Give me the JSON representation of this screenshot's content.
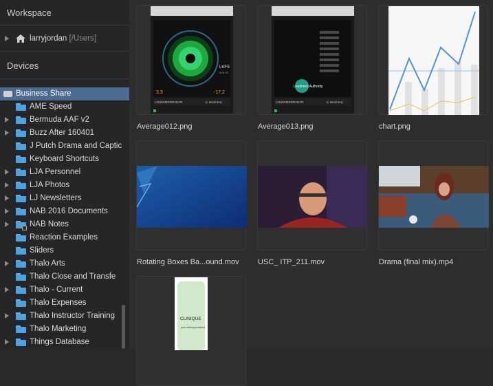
{
  "sidebar": {
    "workspace_header": "Workspace",
    "devices_header": "Devices",
    "user": {
      "name": "larryjordan",
      "path": "[/Users]"
    },
    "business_share": "Business Share",
    "folders": [
      {
        "label": "AME Speed",
        "expandable": false
      },
      {
        "label": "Bermuda AAF v2",
        "expandable": true
      },
      {
        "label": "Buzz After 160401",
        "expandable": true
      },
      {
        "label": "J Putch Drama and Captic",
        "expandable": false
      },
      {
        "label": "Keyboard Shortcuts",
        "expandable": false
      },
      {
        "label": "LJA Personnel",
        "expandable": true
      },
      {
        "label": "LJA Photos",
        "expandable": true
      },
      {
        "label": "LJ Newsletters",
        "expandable": true
      },
      {
        "label": "NAB 2016 Documents",
        "expandable": true
      },
      {
        "label": "NAB Notes",
        "expandable": true,
        "locked": true
      },
      {
        "label": "Reaction Examples",
        "expandable": false
      },
      {
        "label": "Sliders",
        "expandable": false
      },
      {
        "label": "Thalo Arts",
        "expandable": true
      },
      {
        "label": "Thalo Close and Transfe",
        "expandable": false
      },
      {
        "label": "Thalo - Current",
        "expandable": true
      },
      {
        "label": "Thalo Expenses",
        "expandable": false
      },
      {
        "label": "Thalo Instructor Training",
        "expandable": true
      },
      {
        "label": "Thalo Marketing",
        "expandable": false
      },
      {
        "label": "Things Database",
        "expandable": true
      }
    ]
  },
  "files": [
    {
      "name": "Average012.png",
      "kind": "loudness-radar-1"
    },
    {
      "name": "Average013.png",
      "kind": "loudness-radar-2"
    },
    {
      "name": "chart.png",
      "kind": "chart"
    },
    {
      "name": "Rotating Boxes Ba...ound.mov",
      "kind": "blue-video"
    },
    {
      "name": "USC_ ITP_211.mov",
      "kind": "interview-video"
    },
    {
      "name": "Drama (final mix).mp4",
      "kind": "drama-video"
    },
    {
      "name": "",
      "kind": "product-image"
    }
  ],
  "thumb_text": {
    "lkfs": "LKFS",
    "lkfs_time": "0:01:57",
    "left_value": "3.3",
    "right_value": "-17.2",
    "brand_left": "LOUDNESSRADAR",
    "brand_right": "tc electronic",
    "loudness_authority": "Loudness Authority",
    "clinique": "CLINIQUE",
    "clinique_sub": "pore refining solutions"
  },
  "colors": {
    "sidebar_bg": "#262627",
    "selection": "#4a6b8f",
    "folder_blue": "#4aa4e2",
    "content_bg": "#2d2d2e"
  }
}
